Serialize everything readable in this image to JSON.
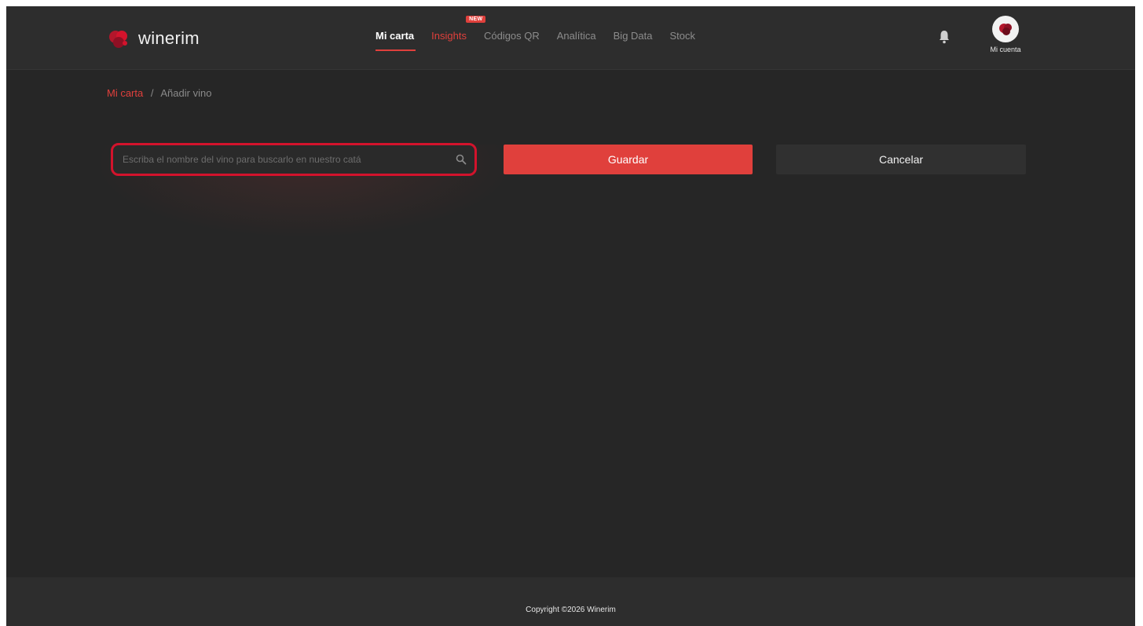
{
  "brand": {
    "name": "winerim",
    "accent_color": "#e0403c",
    "background_color": "#262626"
  },
  "nav": {
    "items": [
      {
        "label": "Mi carta",
        "state": "active"
      },
      {
        "label": "Insights",
        "state": "accent",
        "badge": "NEW"
      },
      {
        "label": "Códigos QR",
        "state": "normal"
      },
      {
        "label": "Analítica",
        "state": "normal"
      },
      {
        "label": "Big Data",
        "state": "normal"
      },
      {
        "label": "Stock",
        "state": "normal"
      }
    ]
  },
  "header": {
    "notification_icon": "bell-icon",
    "account_label": "Mi cuenta"
  },
  "breadcrumb": {
    "parent": "Mi carta",
    "separator": "/",
    "current": "Añadir vino"
  },
  "search": {
    "placeholder": "Escriba el nombre del vino para buscarlo en nuestro catá",
    "value": "",
    "icon": "search-icon"
  },
  "actions": {
    "save_label": "Guardar",
    "cancel_label": "Cancelar"
  },
  "footer": {
    "copyright": "Copyright ©2026 Winerim"
  }
}
